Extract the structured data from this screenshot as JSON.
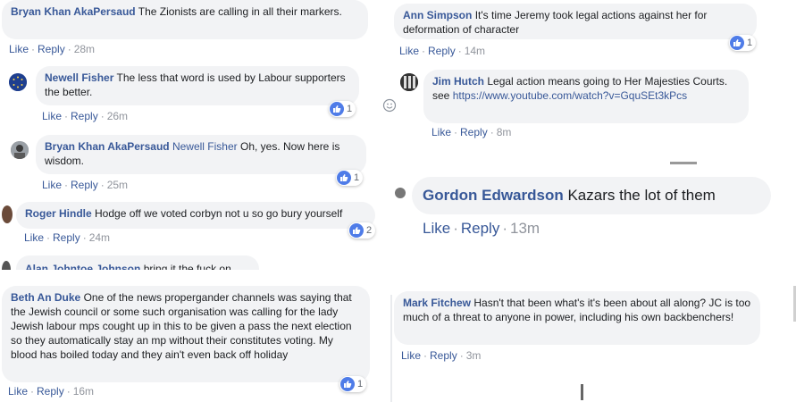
{
  "comments": [
    {
      "author": "Bryan Khan AkaPersaud",
      "text": "The Zionists are calling in all their markers.",
      "like": "Like",
      "reply": "Reply",
      "time": "28m"
    },
    {
      "author": "Newell Fisher",
      "text": "The less that word is used by Labour supporters the better.",
      "like": "Like",
      "reply": "Reply",
      "time": "26m",
      "reactions": "1"
    },
    {
      "author": "Bryan Khan AkaPersaud",
      "mention": "Newell Fisher",
      "text": "Oh, yes. Now here is wisdom.",
      "like": "Like",
      "reply": "Reply",
      "time": "25m",
      "reactions": "1"
    },
    {
      "author": "Roger Hindle",
      "text": "Hodge off we voted corbyn not u so go bury yourself",
      "like": "Like",
      "reply": "Reply",
      "time": "24m",
      "reactions": "2"
    },
    {
      "author": "Alan Johntoe Johnson",
      "text": "bring it the fuck on"
    },
    {
      "author": "Ann Simpson",
      "text": "It's time Jeremy took legal actions against her for deformation of character",
      "like": "Like",
      "reply": "Reply",
      "time": "14m",
      "reactions": "1"
    },
    {
      "author": "Jim Hutch",
      "text": "Legal action means going to Her Majesties Courts. see",
      "link": "https://www.youtube.com/watch?v=GquSEt3kPcs",
      "like": "Like",
      "reply": "Reply",
      "time": "8m"
    },
    {
      "author": "Gordon Edwardson",
      "text": "Kazars the lot of them",
      "like": "Like",
      "reply": "Reply",
      "time": "13m"
    },
    {
      "author": "Beth An Duke",
      "text": "One of the news propergander channels was saying that the Jewish council or some such organisation was calling for the lady Jewish labour mps cought up in this to be given a pass the next election so they automatically stay an mp without their constitutes voting. My blood has boiled today and they ain't even back off holiday",
      "like": "Like",
      "reply": "Reply",
      "time": "16m",
      "reactions": "1"
    },
    {
      "author": "Mark Fitchew",
      "text": "Hasn't that been what's it's been about all along? JC is too much of a threat to anyone in power, including his own backbenchers!",
      "like": "Like",
      "reply": "Reply",
      "time": "3m"
    }
  ],
  "colors": {
    "author": "#385898",
    "bubble": "#f2f3f5",
    "meta_time": "#90949c",
    "like_blue": "#4f7ce8"
  }
}
